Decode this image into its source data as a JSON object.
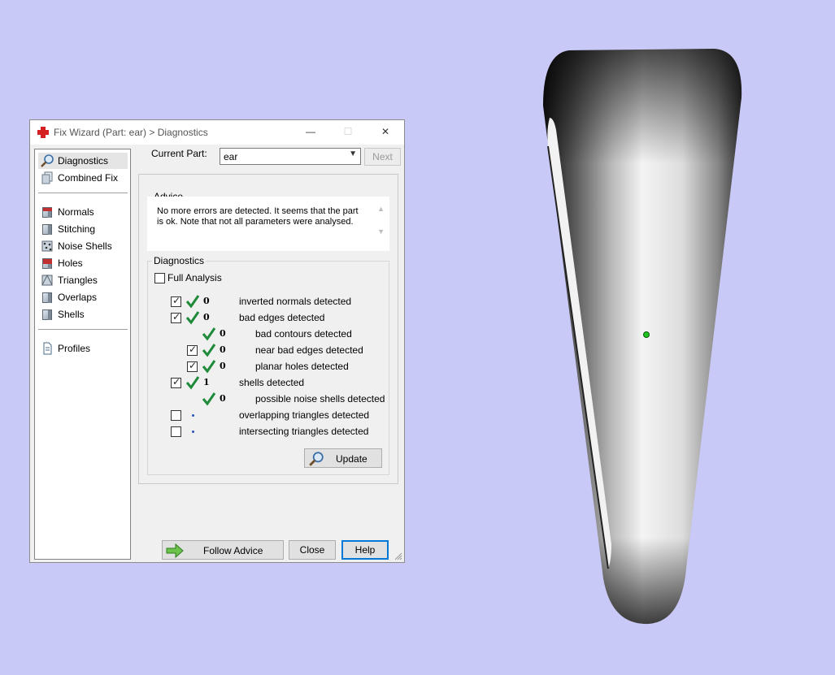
{
  "window": {
    "title": "Fix Wizard (Part: ear) > Diagnostics",
    "controls": {
      "minimize": "—",
      "maximize": "☐",
      "close": "✕"
    }
  },
  "nav": {
    "items": [
      {
        "id": "diagnostics",
        "label": "Diagnostics",
        "icon": "magnifier-icon",
        "selected": true
      },
      {
        "id": "combined-fix",
        "label": "Combined Fix",
        "icon": "stack-icon"
      },
      {
        "id": "normals",
        "label": "Normals",
        "icon": "cube-normals-icon"
      },
      {
        "id": "stitching",
        "label": "Stitching",
        "icon": "cube-stitching-icon"
      },
      {
        "id": "noise-shells",
        "label": "Noise Shells",
        "icon": "noise-cube-icon"
      },
      {
        "id": "holes",
        "label": "Holes",
        "icon": "cube-holes-icon"
      },
      {
        "id": "triangles",
        "label": "Triangles",
        "icon": "cube-triangles-icon"
      },
      {
        "id": "overlaps",
        "label": "Overlaps",
        "icon": "cube-overlaps-icon"
      },
      {
        "id": "shells",
        "label": "Shells",
        "icon": "cube-shells-icon"
      },
      {
        "id": "profiles",
        "label": "Profiles",
        "icon": "document-icon"
      }
    ]
  },
  "current_part": {
    "label": "Current Part:",
    "value": "ear",
    "next_label": "Next"
  },
  "advice": {
    "title": "Advice",
    "text": "No more errors are detected. It seems that the part is ok. Note that not all parameters were analysed."
  },
  "diagnostics": {
    "title": "Diagnostics",
    "full_analysis": {
      "label": "Full Analysis",
      "checked": false
    },
    "rows": [
      {
        "checkbox": true,
        "checked": true,
        "status": "ok",
        "count": "0",
        "label": "inverted normals detected",
        "level": 0
      },
      {
        "checkbox": true,
        "checked": true,
        "status": "ok",
        "count": "0",
        "label": "bad edges detected",
        "level": 0
      },
      {
        "checkbox": false,
        "status": "ok",
        "count": "0",
        "label": "bad contours detected",
        "level": 1
      },
      {
        "checkbox": true,
        "checked": true,
        "status": "ok",
        "count": "0",
        "label": "near bad edges detected",
        "level": 1
      },
      {
        "checkbox": true,
        "checked": true,
        "status": "ok",
        "count": "0",
        "label": "planar holes detected",
        "level": 1
      },
      {
        "checkbox": true,
        "checked": true,
        "status": "ok",
        "count": "1",
        "label": "shells detected",
        "level": 0
      },
      {
        "checkbox": false,
        "status": "ok",
        "count": "0",
        "label": "possible noise shells detected",
        "level": 1
      },
      {
        "checkbox": true,
        "checked": false,
        "status": "pending",
        "count": "",
        "label": "overlapping triangles detected",
        "level": 0
      },
      {
        "checkbox": true,
        "checked": false,
        "status": "pending",
        "count": "",
        "label": "intersecting triangles detected",
        "level": 0
      }
    ],
    "update_label": "Update"
  },
  "footer": {
    "follow_advice_label": "Follow Advice",
    "close_label": "Close",
    "help_label": "Help"
  },
  "colors": {
    "background": "#c9c9f7",
    "check_green": "#1f8a3a",
    "pending_blue": "#2a52be",
    "accent": "#0078d7"
  }
}
